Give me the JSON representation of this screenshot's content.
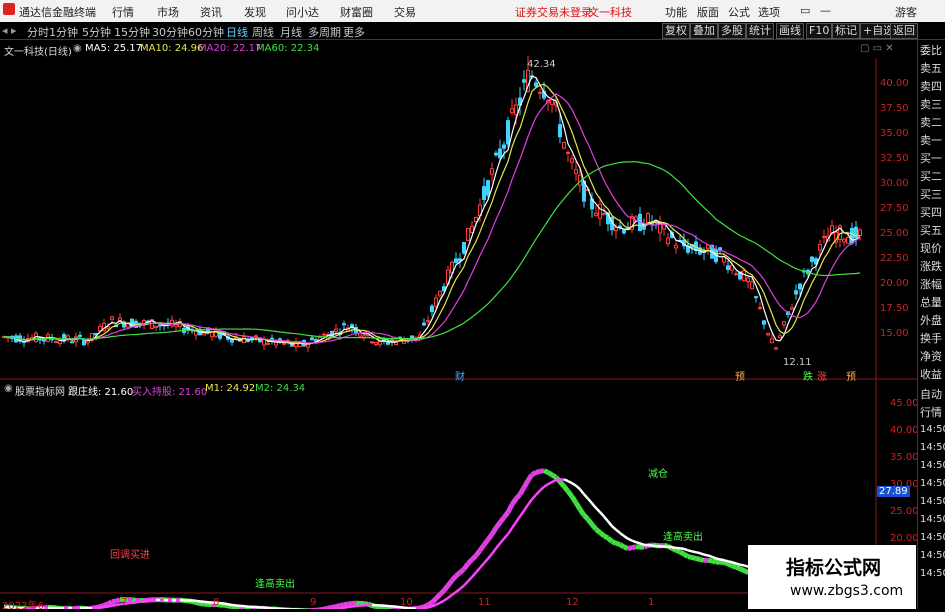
{
  "topbar": {
    "app_title": "通达信金融终端",
    "menus": [
      "行情",
      "市场",
      "资讯",
      "发现",
      "问小达",
      "财富圈",
      "交易"
    ],
    "notice": "证券交易未登录",
    "stock_name": "文一科技",
    "right_menus": [
      "功能",
      "版面",
      "公式",
      "选项"
    ],
    "guest": "游客"
  },
  "periodbar": {
    "periods": [
      "分时",
      "1分钟",
      "5分钟",
      "15分钟",
      "30分钟",
      "60分钟",
      "日线",
      "周线",
      "月线",
      "多周期",
      "更多"
    ],
    "active": "日线",
    "tools": [
      "复权",
      "叠加",
      "多股",
      "统计",
      "画线",
      "F10",
      "标记",
      "+自选",
      "返回"
    ]
  },
  "main_chart": {
    "title": "文一科技(日线)",
    "ma_labels": [
      {
        "text": "MA5: 25.17",
        "color": "#ffffff"
      },
      {
        "text": "MA10: 24.96",
        "color": "#e8e84a"
      },
      {
        "text": "MA20: 22.17",
        "color": "#e040e0"
      },
      {
        "text": "MA60: 22.34",
        "color": "#40e040"
      }
    ],
    "y_ticks": [
      "40.00",
      "37.50",
      "35.00",
      "32.50",
      "30.00",
      "27.50",
      "25.00",
      "22.50",
      "20.00",
      "17.50",
      "15.00"
    ],
    "high_label": "42.34",
    "low_label": "12.11",
    "markers": [
      "财",
      "预",
      "跌",
      "涨",
      "预"
    ]
  },
  "indicator": {
    "title": "股票指标网",
    "label1": "跟庄线: 21.60",
    "label2": "买入持股: 21.60",
    "label3": "M1: 24.92",
    "label4": "M2: 24.34",
    "y_ticks": [
      "45.00",
      "40.00",
      "35.00",
      "30.00",
      "25.00",
      "20.00"
    ],
    "current_value": "27.89",
    "annotations": [
      "减仓",
      "回调买进",
      "逢高卖出",
      "逢高卖出"
    ]
  },
  "right_panel": {
    "items": [
      "委比",
      "卖五",
      "卖四",
      "卖三",
      "卖二",
      "卖一",
      "买一",
      "买二",
      "买三",
      "买四",
      "买五",
      "现价",
      "涨跌",
      "涨幅",
      "总量",
      "外盘",
      "换手",
      "净资",
      "收益"
    ],
    "items2": [
      "自动",
      "行情"
    ],
    "times": [
      "14:50",
      "14:50",
      "14:50",
      "14:50",
      "14:50",
      "14:50",
      "14:50",
      "14:50",
      "14:50"
    ]
  },
  "date_axis": [
    "2023年6",
    "7",
    "8",
    "9",
    "10",
    "11",
    "12",
    "1"
  ],
  "watermark": {
    "title": "指标公式网",
    "url": "www.zbgs3.com"
  },
  "colors": {
    "up": "#ff3b3b",
    "down": "#3fd3ff",
    "ma5": "#ffffff",
    "ma10": "#e8e84a",
    "ma20": "#e040e0",
    "ma60": "#40e040",
    "grid": "#7a1010"
  }
}
